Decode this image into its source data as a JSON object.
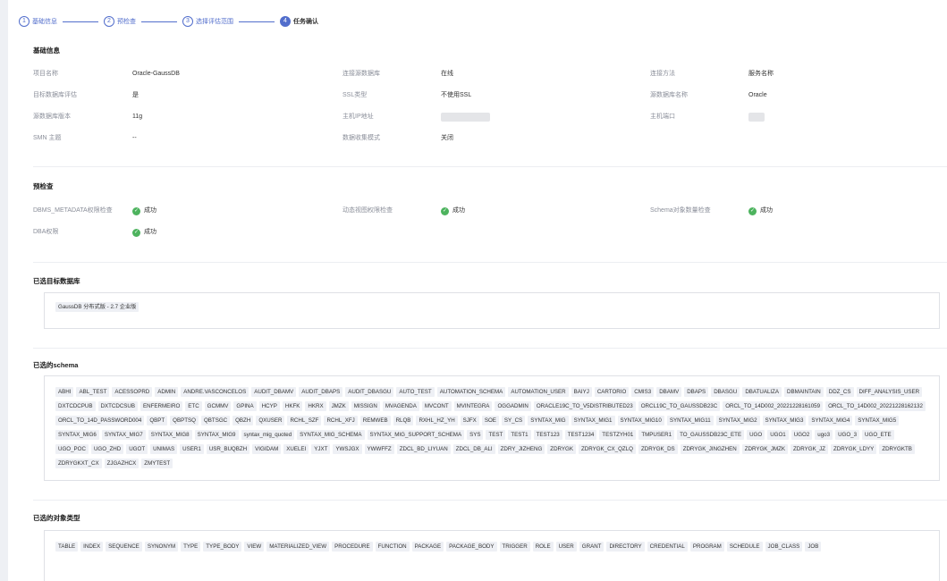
{
  "steps": [
    {
      "num": "1",
      "label": "基础信息"
    },
    {
      "num": "2",
      "label": "预检查"
    },
    {
      "num": "3",
      "label": "选择评估范围"
    },
    {
      "num": "4",
      "label": "任务确认"
    }
  ],
  "basic": {
    "title": "基础信息",
    "project_name_label": "项目名称",
    "project_name": "Oracle-GaussDB",
    "conn_source_label": "连接源数据库",
    "conn_source": "在线",
    "conn_method_label": "连接方法",
    "conn_method": "服务名称",
    "target_eval_label": "目标数据库评估",
    "target_eval": "是",
    "ssl_type_label": "SSL类型",
    "ssl_type": "不使用SSL",
    "source_db_name_label": "源数据库名称",
    "source_db_name": "Oracle",
    "source_db_version_label": "源数据库版本",
    "source_db_version": "11g",
    "host_ip_label": "主机IP地址",
    "host_port_label": "主机端口",
    "smn_label": "SMN 主题",
    "smn": "--",
    "data_collect_label": "数据收集模式",
    "data_collect": "关闭"
  },
  "precheck": {
    "title": "预检查",
    "items": [
      {
        "label": "DBMS_METADATA权限检查",
        "status": "成功"
      },
      {
        "label": "动态视图权限检查",
        "status": "成功"
      },
      {
        "label": "Schema对象数量检查",
        "status": "成功"
      },
      {
        "label": "DBA权限",
        "status": "成功"
      }
    ]
  },
  "target_db": {
    "title": "已选目标数据库",
    "tags": [
      "GaussDB 分布式版 - 2.7 企业版"
    ]
  },
  "schemas": {
    "title": "已选的schema",
    "tags": [
      "ABHI",
      "ABL_TEST",
      "ACESSOPRD",
      "ADMIN",
      "ANDRE.VASCONCELOS",
      "AUDIT_DBAMV",
      "AUDIT_DBAPS",
      "AUDIT_DBASGU",
      "AUTO_TEST",
      "AUTOMATION_SCHEMA",
      "AUTOMATION_USER",
      "BAIYJ",
      "CARTORIO",
      "CMIS3",
      "DBAMV",
      "DBAPS",
      "DBASGU",
      "DBATUALIZA",
      "DBMAINTAIN",
      "DDZ_CS",
      "DIFF_ANALYSIS_USER",
      "DXTCDCPUB",
      "DXTCDCSUB",
      "ENFERMEIRO",
      "ETC",
      "GCMMV",
      "GPINA",
      "HCYP",
      "HKFK",
      "HKRX",
      "JMZK",
      "MISSIGN",
      "MVAGENDA",
      "MVCONT",
      "MVINTEGRA",
      "OGGADMIN",
      "ORACLE19C_TO_V5DISTRIBUTED23",
      "ORCL19C_TO_GAUSSDB23C",
      "ORCL_TO_14D002_20221228161059",
      "ORCL_TO_14D002_20221228162132",
      "ORCL_TO_14D_PASSWORD004",
      "QBPT",
      "QBPTSQ",
      "QBTSGC",
      "QBZH",
      "QXUSER",
      "RCHL_SZF",
      "RCHL_XFJ",
      "REMWEB",
      "RLQB",
      "RXHL_HZ_YH",
      "SJFX",
      "SOE",
      "SY_CS",
      "SYNTAX_MIG",
      "SYNTAX_MIG1",
      "SYNTAX_MIG10",
      "SYNTAX_MIG11",
      "SYNTAX_MIG2",
      "SYNTAX_MIG3",
      "SYNTAX_MIG4",
      "SYNTAX_MIG5",
      "SYNTAX_MIG6",
      "SYNTAX_MIG7",
      "SYNTAX_MIG8",
      "SYNTAX_MIG9",
      "syntax_mig_quoted",
      "SYNTAX_MIG_SCHEMA",
      "SYNTAX_MIG_SUPPORT_SCHEMA",
      "SYS",
      "TEST",
      "TEST1",
      "TEST123",
      "TEST1234",
      "TESTZYH01",
      "TMPUSER1",
      "TO_GAUSSDB23C_ETE",
      "UGO",
      "UGO1",
      "UGO2",
      "ugo3",
      "UGO_3",
      "UGO_ETE",
      "UGO_POC",
      "UGO_ZHD",
      "UGOT",
      "UNIMAS",
      "USER1",
      "USR_BUQBZH",
      "VIGIDAM",
      "XUELEI",
      "YJXT",
      "YWSJGX",
      "YWWFFZ",
      "ZDCL_BD_LIYUAN",
      "ZDCL_DB_ALI",
      "ZDRY_JIZHENG",
      "ZDRYGK",
      "ZDRYGK_CX_QZLQ",
      "ZDRYGK_DS",
      "ZDRYGK_JINGZHEN",
      "ZDRYGK_JMZK",
      "ZDRYGK_JZ",
      "ZDRYGK_LDYY",
      "ZDRYGKTB",
      "ZDRYGKXT_CX",
      "ZJGAZHCX",
      "ZMYTEST"
    ]
  },
  "object_types": {
    "title": "已选的对象类型",
    "tags": [
      "TABLE",
      "INDEX",
      "SEQUENCE",
      "SYNONYM",
      "TYPE",
      "TYPE_BODY",
      "VIEW",
      "MATERIALIZED_VIEW",
      "PROCEDURE",
      "FUNCTION",
      "PACKAGE",
      "PACKAGE_BODY",
      "TRIGGER",
      "ROLE",
      "USER",
      "GRANT",
      "DIRECTORY",
      "CREDENTIAL",
      "PROGRAM",
      "SCHEDULE",
      "JOB_CLASS",
      "JOB"
    ]
  },
  "icons": {
    "success": "check-circle-icon"
  },
  "colors": {
    "accent": "#526ecc",
    "success": "#4db35e"
  }
}
